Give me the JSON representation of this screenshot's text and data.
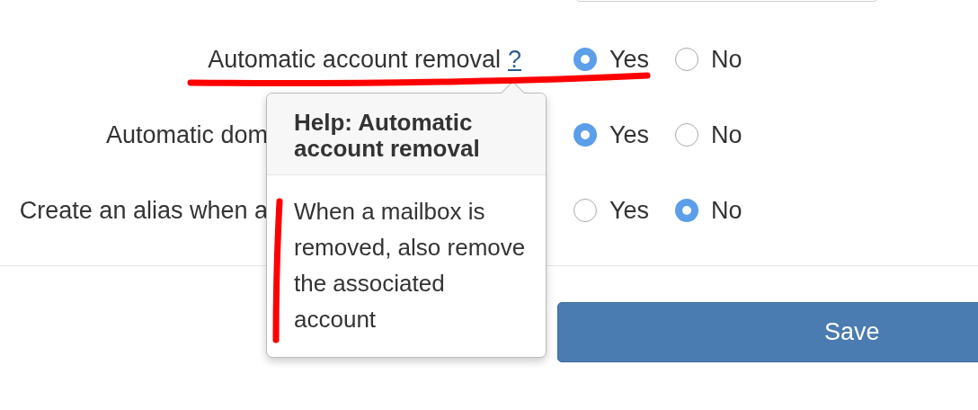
{
  "rows": [
    {
      "label": "Automatic account removal",
      "help": "?",
      "options": [
        {
          "label": "Yes",
          "selected": true
        },
        {
          "label": "No",
          "selected": false
        }
      ]
    },
    {
      "label": "Automatic dom",
      "options": [
        {
          "label": "Yes",
          "selected": true
        },
        {
          "label": "No",
          "selected": false
        }
      ]
    },
    {
      "label": "Create an alias when a",
      "options": [
        {
          "label": "Yes",
          "selected": false
        },
        {
          "label": "No",
          "selected": true
        }
      ]
    }
  ],
  "popover": {
    "title": "Help: Automatic account removal",
    "body": "When a mailbox is removed, also remove the associated account"
  },
  "save_button": "Save"
}
